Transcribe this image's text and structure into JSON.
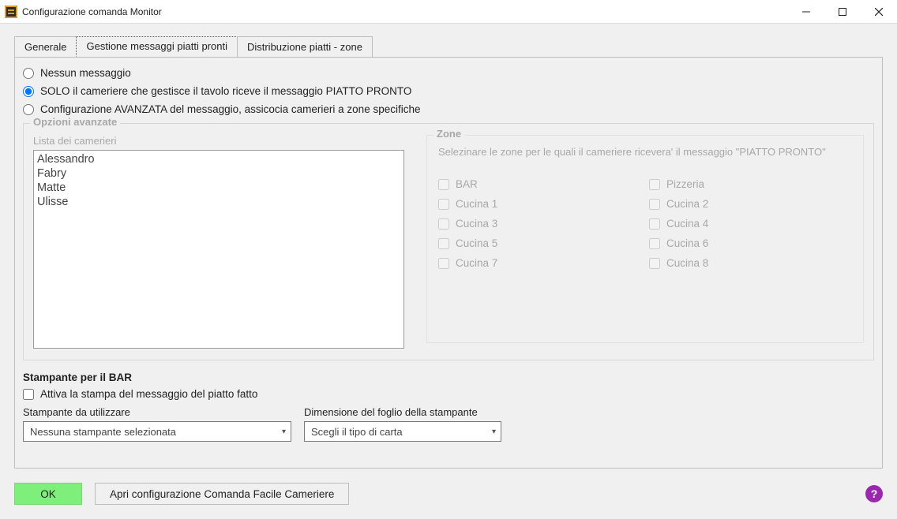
{
  "window": {
    "title": "Configurazione comanda Monitor"
  },
  "tabs": [
    {
      "label": "Generale"
    },
    {
      "label": "Gestione messaggi piatti pronti"
    },
    {
      "label": "Distribuzione piatti - zone"
    }
  ],
  "radios": {
    "none": "Nessun messaggio",
    "only_waiter": "SOLO il cameriere che gestisce il tavolo riceve il messaggio PIATTO PRONTO",
    "advanced": "Configurazione AVANZATA del messaggio, assicocia camerieri a zone specifiche"
  },
  "advanced": {
    "group_title": "Opzioni avanzate",
    "waiters_label": "Lista dei camerieri",
    "waiters": [
      "Alessandro",
      "Fabry",
      "Matte",
      "Ulisse"
    ],
    "zones": {
      "title": "Zone",
      "help": "Selezinare le zone per le quali il cameriere ricevera' il messaggio \"PIATTO PRONTO\"",
      "items": [
        "BAR",
        "Pizzeria",
        "Cucina 1",
        "Cucina 2",
        "Cucina 3",
        "Cucina 4",
        "Cucina 5",
        "Cucina 6",
        "Cucina 7",
        "Cucina 8"
      ]
    }
  },
  "printer": {
    "heading": "Stampante per il BAR",
    "toggle_label": "Attiva la stampa del messaggio del piatto fatto",
    "printer_label": "Stampante da utilizzare",
    "printer_value": "Nessuna stampante selezionata",
    "paper_label": "Dimensione del foglio della stampante",
    "paper_value": "Scegli il tipo di carta"
  },
  "buttons": {
    "ok": "OK",
    "open_config": "Apri configurazione Comanda Facile Cameriere",
    "help": "?"
  }
}
